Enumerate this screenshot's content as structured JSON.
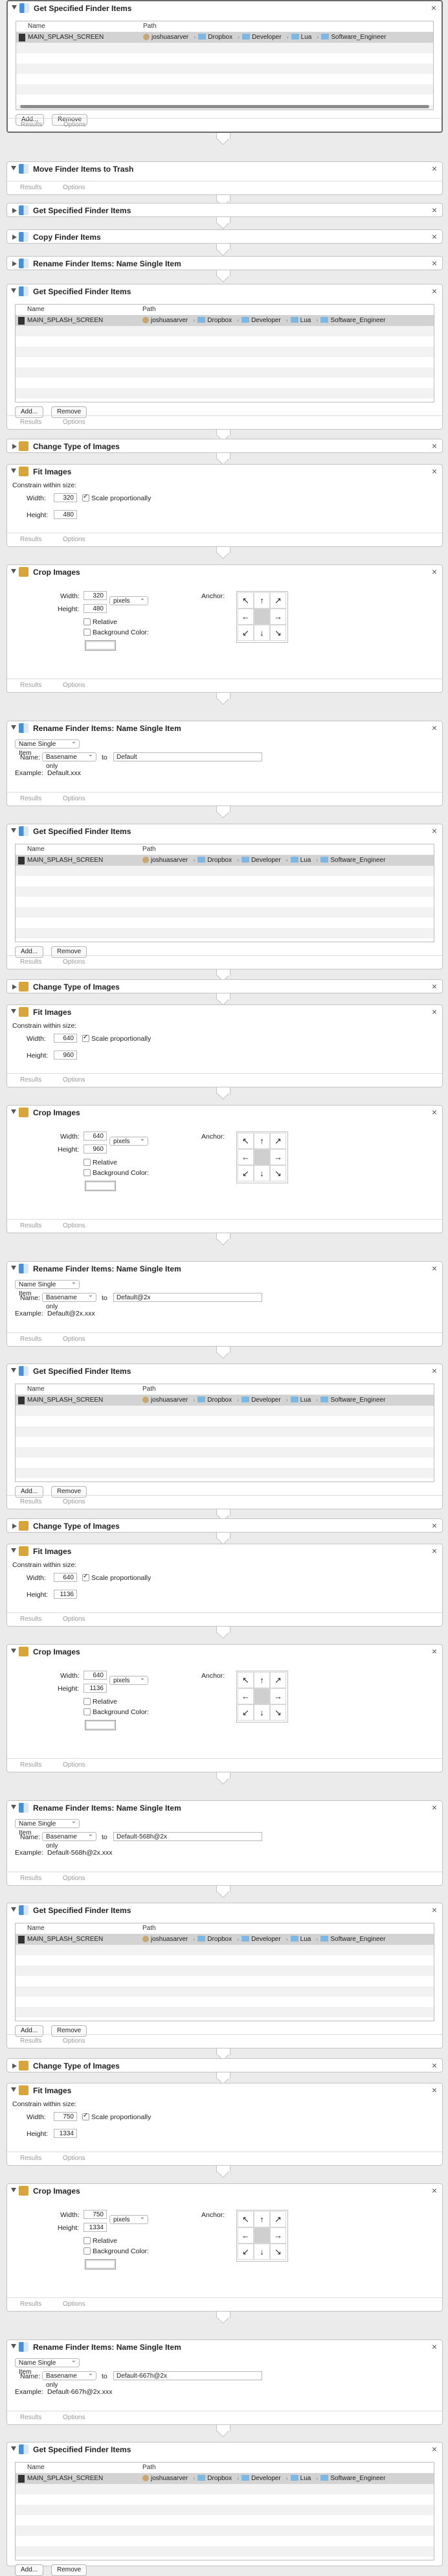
{
  "common": {
    "footer": {
      "results": "Results",
      "options": "Options"
    },
    "finder": {
      "col_name": "Name",
      "col_path": "Path",
      "file_name": "MAIN_SPLASH_SCREEN",
      "path": [
        "joshuasarver",
        "Dropbox",
        "Developer",
        "Lua",
        "Software_Engineer"
      ],
      "add_label": "Add...",
      "remove_label": "Remove"
    },
    "fit": {
      "constrain": "Constrain within size:",
      "width_label": "Width:",
      "height_label": "Height:",
      "scale_label": "Scale proportionally"
    },
    "crop": {
      "width_label": "Width:",
      "height_label": "Height:",
      "units": "pixels",
      "anchor_label": "Anchor:",
      "relative_label": "Relative",
      "bgcolor_label": "Background Color:"
    },
    "rename": {
      "mode": "Name Single Item",
      "name_label": "Name:",
      "basename_option": "Basename only",
      "to_label": "to",
      "example_label": "Example:"
    },
    "anchor_arrows": [
      "↖",
      "↑",
      "↗",
      "←",
      "",
      "→",
      "↙",
      "↓",
      "↘"
    ]
  },
  "actions": [
    {
      "title": "Get Specified Finder Items"
    },
    {
      "title": "Move Finder Items to Trash"
    },
    {
      "title": "Get Specified Finder Items"
    },
    {
      "title": "Copy Finder Items"
    },
    {
      "title": "Rename Finder Items: Name Single Item"
    },
    {
      "title": "Get Specified Finder Items"
    },
    {
      "title": "Change Type of Images"
    },
    {
      "title": "Fit Images",
      "width": "320",
      "height": "480"
    },
    {
      "title": "Crop Images",
      "width": "320",
      "height": "480"
    },
    {
      "title": "Rename Finder Items: Name Single Item",
      "new_name": "Default",
      "example": "Default.xxx"
    },
    {
      "title": "Get Specified Finder Items"
    },
    {
      "title": "Change Type of Images"
    },
    {
      "title": "Fit Images",
      "width": "640",
      "height": "960"
    },
    {
      "title": "Crop Images",
      "width": "640",
      "height": "960"
    },
    {
      "title": "Rename Finder Items: Name Single Item",
      "new_name": "Default@2x",
      "example": "Default@2x.xxx"
    },
    {
      "title": "Get Specified Finder Items"
    },
    {
      "title": "Change Type of Images"
    },
    {
      "title": "Fit Images",
      "width": "640",
      "height": "1136"
    },
    {
      "title": "Crop Images",
      "width": "640",
      "height": "1136"
    },
    {
      "title": "Rename Finder Items: Name Single Item",
      "new_name": "Default-568h@2x",
      "example": "Default-568h@2x.xxx"
    },
    {
      "title": "Get Specified Finder Items"
    },
    {
      "title": "Change Type of Images"
    },
    {
      "title": "Fit Images",
      "width": "750",
      "height": "1334"
    },
    {
      "title": "Crop Images",
      "width": "750",
      "height": "1334"
    },
    {
      "title": "Rename Finder Items: Name Single Item",
      "new_name": "Default-667h@2x",
      "example": "Default-667h@2x.xxx"
    },
    {
      "title": "Get Specified Finder Items"
    }
  ]
}
